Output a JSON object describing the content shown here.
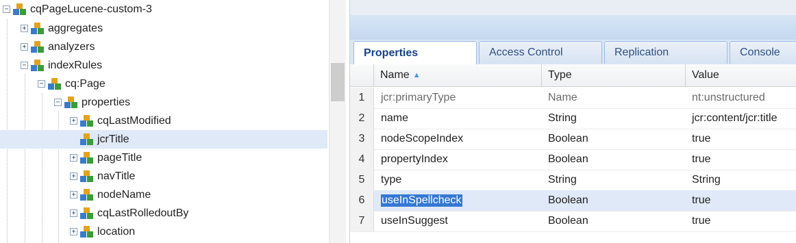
{
  "tree": {
    "nodes": [
      {
        "label": "cqPageLucene-custom-3",
        "toggle": "−"
      },
      {
        "label": "aggregates",
        "toggle": "+"
      },
      {
        "label": "analyzers",
        "toggle": "+"
      },
      {
        "label": "indexRules",
        "toggle": "−"
      },
      {
        "label": "cq:Page",
        "toggle": "−"
      },
      {
        "label": "properties",
        "toggle": "−"
      },
      {
        "label": "cqLastModified",
        "toggle": "+"
      },
      {
        "label": "jcrTitle",
        "toggle": ""
      },
      {
        "label": "pageTitle",
        "toggle": "+"
      },
      {
        "label": "navTitle",
        "toggle": "+"
      },
      {
        "label": "nodeName",
        "toggle": "+"
      },
      {
        "label": "cqLastRolledoutBy",
        "toggle": "+"
      },
      {
        "label": "location",
        "toggle": "+"
      }
    ]
  },
  "topstrip": {
    "text": ""
  },
  "tabs": [
    "Properties",
    "Access Control",
    "Replication",
    "Console"
  ],
  "grid": {
    "columns": [
      "Name",
      "Type",
      "Value"
    ],
    "sort_arrow": "▲",
    "rows": [
      {
        "num": "1",
        "name": "jcr:primaryType",
        "type": "Name",
        "value": "nt:unstructured"
      },
      {
        "num": "2",
        "name": "name",
        "type": "String",
        "value": "jcr:content/jcr:title"
      },
      {
        "num": "3",
        "name": "nodeScopeIndex",
        "type": "Boolean",
        "value": "true"
      },
      {
        "num": "4",
        "name": "propertyIndex",
        "type": "Boolean",
        "value": "true"
      },
      {
        "num": "5",
        "name": "type",
        "type": "String",
        "value": "String"
      },
      {
        "num": "6",
        "name": "useInSpellcheck",
        "type": "Boolean",
        "value": "true"
      },
      {
        "num": "7",
        "name": "useInSuggest",
        "type": "Boolean",
        "value": "true"
      }
    ]
  },
  "colors": {
    "accent": "#15428b",
    "selection": "#dfe9f7",
    "text_highlight": "#3478d4"
  },
  "icons": {
    "node": "node-cubes-icon"
  }
}
